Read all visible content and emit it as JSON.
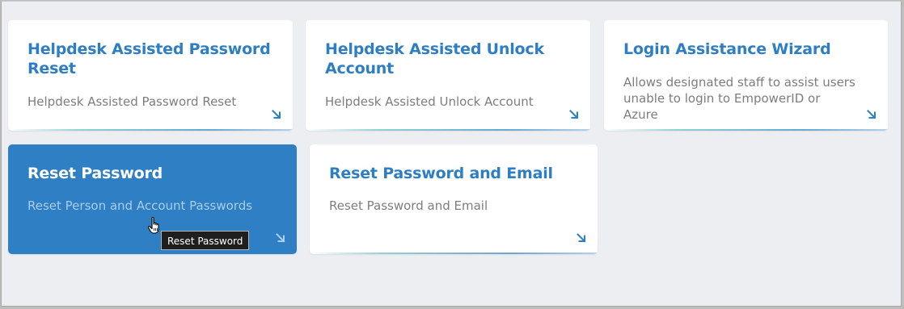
{
  "cards": [
    {
      "title": "Helpdesk Assisted Password Reset",
      "description": "Helpdesk Assisted Password Reset"
    },
    {
      "title": "Helpdesk Assisted Unlock Account",
      "description": "Helpdesk Assisted Unlock Account"
    },
    {
      "title": "Login Assistance Wizard",
      "description": "Allows designated staff to assist users unable to login to EmpowerID or Azure"
    },
    {
      "title": "Reset Password",
      "description": "Reset Person and Account Passwords"
    },
    {
      "title": "Reset Password and Email",
      "description": "Reset Password and Email"
    }
  ],
  "tooltip": {
    "text": "Reset Password"
  },
  "icons": {
    "card_arrow": "arrow-down-right-icon",
    "cursor": "hand-pointer-cursor-icon"
  },
  "colors": {
    "accent": "#2d7ec4",
    "active_card_bg": "#2f7fc4",
    "page_bg": "#eceef2",
    "card_bg": "#ffffff",
    "description_text": "#7d7d7d"
  }
}
